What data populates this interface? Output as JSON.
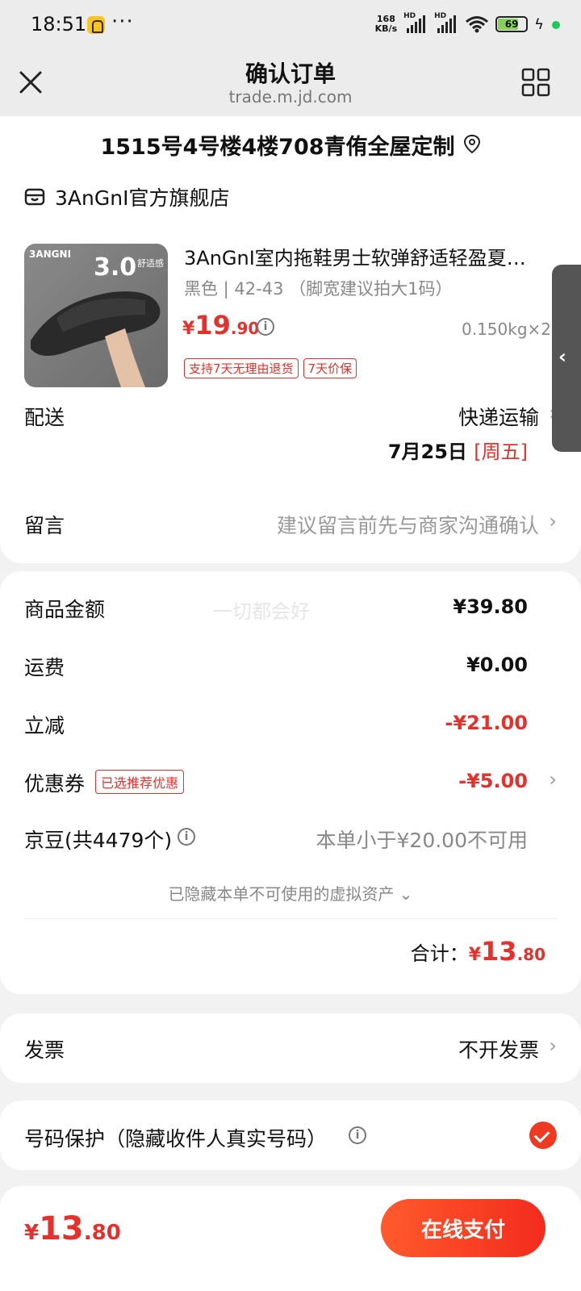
{
  "status_bar": {
    "time": "18:51",
    "dots": "···",
    "speed": "168\nKB/s",
    "hd1": "HD",
    "hd2": "HD",
    "battery": "69"
  },
  "nav": {
    "title": "确认订单",
    "url": "trade.m.jd.com"
  },
  "address": {
    "text": "1515号4号楼4楼708青侑全屋定制"
  },
  "shop": {
    "name": "3AnGnI官方旗舰店"
  },
  "product": {
    "thumb_brand": "3ANGNI",
    "thumb_big": "3.0",
    "thumb_small": "舒适感",
    "name": "3AnGnI室内拖鞋男士软弹舒适轻盈夏…",
    "spec": "黑色 | 42-43 （脚宽建议拍大1码）",
    "price_symbol": "¥",
    "price_int": "19",
    "price_dec": ".90",
    "weight": "0.150kg×2",
    "tags": [
      "支持7天无理由退货",
      "7天价保"
    ]
  },
  "delivery": {
    "label": "配送",
    "method": "快递运输",
    "date": "7月25日 ",
    "weekday": "[周五]"
  },
  "message": {
    "label": "留言",
    "placeholder": "建议留言前先与商家沟通确认"
  },
  "summary": {
    "watermark": "一切都会好",
    "goods_label": "商品金额",
    "goods_value": "¥39.80",
    "shipping_label": "运费",
    "shipping_value": "¥0.00",
    "discount_label": "立减",
    "discount_value": "-¥21.00",
    "coupon_label": "优惠券",
    "coupon_badge": "已选推荐优惠",
    "coupon_value": "-¥5.00",
    "jd_beans_label": "京豆(共4479个)",
    "jd_beans_value": "本单小于¥20.00不可用",
    "hidden_assets": "已隐藏本单不可使用的虚拟资产 ⌄",
    "total_label": "合计：",
    "total_symbol": "¥",
    "total_int": "13",
    "total_dec": ".80"
  },
  "invoice": {
    "label": "发票",
    "value": "不开发票"
  },
  "privacy": {
    "label": "号码保护（隐藏收件人真实号码）"
  },
  "bottom": {
    "price_symbol": "¥",
    "price_int": "13",
    "price_dec": ".80",
    "pay_label": "在线支付"
  },
  "colors": {
    "accent": "#e4312b",
    "pay_button": "#f32b1d",
    "background": "#f2f2f2"
  }
}
